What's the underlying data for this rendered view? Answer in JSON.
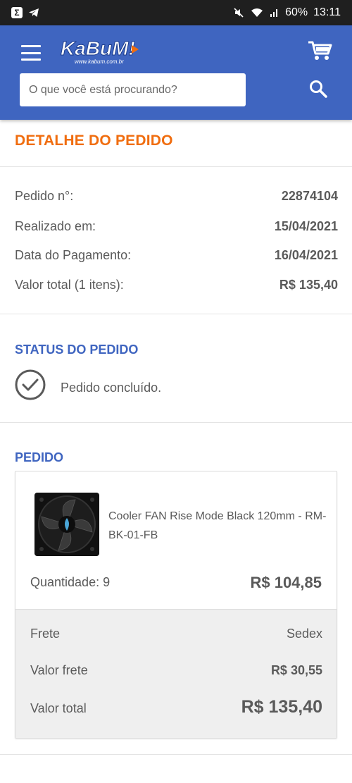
{
  "status_bar": {
    "battery": "60%",
    "time": "13:11",
    "left_icon": "Σ"
  },
  "header": {
    "brand_name": "KaBuM!",
    "brand_url": "www.kabum.com.br",
    "search_placeholder": "O que você está procurando?"
  },
  "order_detail": {
    "title": "DETALHE DO PEDIDO",
    "rows": [
      {
        "label": "Pedido n°:",
        "value": "22874104"
      },
      {
        "label": "Realizado em:",
        "value": "15/04/2021"
      },
      {
        "label": "Data do Pagamento:",
        "value": "16/04/2021"
      },
      {
        "label": "Valor total (1 itens):",
        "value": "R$ 135,40"
      }
    ]
  },
  "status": {
    "title": "STATUS DO PEDIDO",
    "text": "Pedido concluído."
  },
  "order": {
    "title": "PEDIDO",
    "product_name": "Cooler FAN Rise Mode Black 120mm - RM-BK-01-FB",
    "quantity_label": "Quantidade: 9",
    "product_price": "R$ 104,85",
    "shipping_label": "Frete",
    "shipping_value": "Sedex",
    "shipping_cost_label": "Valor frete",
    "shipping_cost_value": "R$ 30,55",
    "total_label": "Valor total",
    "total_value": "R$ 135,40"
  },
  "colors": {
    "brand_blue": "#3f65c0",
    "accent_orange": "#f06d0f",
    "text_gray": "#5a5a5a"
  }
}
